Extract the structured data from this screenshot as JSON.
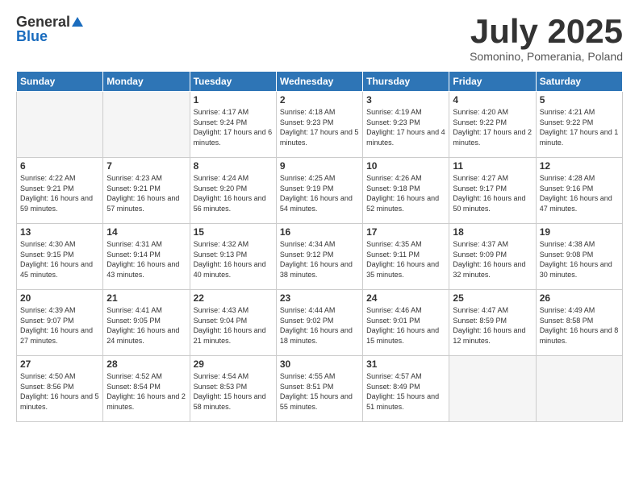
{
  "header": {
    "logo_general": "General",
    "logo_blue": "Blue",
    "month_title": "July 2025",
    "location": "Somonino, Pomerania, Poland"
  },
  "days_of_week": [
    "Sunday",
    "Monday",
    "Tuesday",
    "Wednesday",
    "Thursday",
    "Friday",
    "Saturday"
  ],
  "weeks": [
    [
      {
        "day": "",
        "empty": true
      },
      {
        "day": "",
        "empty": true
      },
      {
        "day": "1",
        "sunrise": "Sunrise: 4:17 AM",
        "sunset": "Sunset: 9:24 PM",
        "daylight": "Daylight: 17 hours and 6 minutes."
      },
      {
        "day": "2",
        "sunrise": "Sunrise: 4:18 AM",
        "sunset": "Sunset: 9:23 PM",
        "daylight": "Daylight: 17 hours and 5 minutes."
      },
      {
        "day": "3",
        "sunrise": "Sunrise: 4:19 AM",
        "sunset": "Sunset: 9:23 PM",
        "daylight": "Daylight: 17 hours and 4 minutes."
      },
      {
        "day": "4",
        "sunrise": "Sunrise: 4:20 AM",
        "sunset": "Sunset: 9:22 PM",
        "daylight": "Daylight: 17 hours and 2 minutes."
      },
      {
        "day": "5",
        "sunrise": "Sunrise: 4:21 AM",
        "sunset": "Sunset: 9:22 PM",
        "daylight": "Daylight: 17 hours and 1 minute."
      }
    ],
    [
      {
        "day": "6",
        "sunrise": "Sunrise: 4:22 AM",
        "sunset": "Sunset: 9:21 PM",
        "daylight": "Daylight: 16 hours and 59 minutes."
      },
      {
        "day": "7",
        "sunrise": "Sunrise: 4:23 AM",
        "sunset": "Sunset: 9:21 PM",
        "daylight": "Daylight: 16 hours and 57 minutes."
      },
      {
        "day": "8",
        "sunrise": "Sunrise: 4:24 AM",
        "sunset": "Sunset: 9:20 PM",
        "daylight": "Daylight: 16 hours and 56 minutes."
      },
      {
        "day": "9",
        "sunrise": "Sunrise: 4:25 AM",
        "sunset": "Sunset: 9:19 PM",
        "daylight": "Daylight: 16 hours and 54 minutes."
      },
      {
        "day": "10",
        "sunrise": "Sunrise: 4:26 AM",
        "sunset": "Sunset: 9:18 PM",
        "daylight": "Daylight: 16 hours and 52 minutes."
      },
      {
        "day": "11",
        "sunrise": "Sunrise: 4:27 AM",
        "sunset": "Sunset: 9:17 PM",
        "daylight": "Daylight: 16 hours and 50 minutes."
      },
      {
        "day": "12",
        "sunrise": "Sunrise: 4:28 AM",
        "sunset": "Sunset: 9:16 PM",
        "daylight": "Daylight: 16 hours and 47 minutes."
      }
    ],
    [
      {
        "day": "13",
        "sunrise": "Sunrise: 4:30 AM",
        "sunset": "Sunset: 9:15 PM",
        "daylight": "Daylight: 16 hours and 45 minutes."
      },
      {
        "day": "14",
        "sunrise": "Sunrise: 4:31 AM",
        "sunset": "Sunset: 9:14 PM",
        "daylight": "Daylight: 16 hours and 43 minutes."
      },
      {
        "day": "15",
        "sunrise": "Sunrise: 4:32 AM",
        "sunset": "Sunset: 9:13 PM",
        "daylight": "Daylight: 16 hours and 40 minutes."
      },
      {
        "day": "16",
        "sunrise": "Sunrise: 4:34 AM",
        "sunset": "Sunset: 9:12 PM",
        "daylight": "Daylight: 16 hours and 38 minutes."
      },
      {
        "day": "17",
        "sunrise": "Sunrise: 4:35 AM",
        "sunset": "Sunset: 9:11 PM",
        "daylight": "Daylight: 16 hours and 35 minutes."
      },
      {
        "day": "18",
        "sunrise": "Sunrise: 4:37 AM",
        "sunset": "Sunset: 9:09 PM",
        "daylight": "Daylight: 16 hours and 32 minutes."
      },
      {
        "day": "19",
        "sunrise": "Sunrise: 4:38 AM",
        "sunset": "Sunset: 9:08 PM",
        "daylight": "Daylight: 16 hours and 30 minutes."
      }
    ],
    [
      {
        "day": "20",
        "sunrise": "Sunrise: 4:39 AM",
        "sunset": "Sunset: 9:07 PM",
        "daylight": "Daylight: 16 hours and 27 minutes."
      },
      {
        "day": "21",
        "sunrise": "Sunrise: 4:41 AM",
        "sunset": "Sunset: 9:05 PM",
        "daylight": "Daylight: 16 hours and 24 minutes."
      },
      {
        "day": "22",
        "sunrise": "Sunrise: 4:43 AM",
        "sunset": "Sunset: 9:04 PM",
        "daylight": "Daylight: 16 hours and 21 minutes."
      },
      {
        "day": "23",
        "sunrise": "Sunrise: 4:44 AM",
        "sunset": "Sunset: 9:02 PM",
        "daylight": "Daylight: 16 hours and 18 minutes."
      },
      {
        "day": "24",
        "sunrise": "Sunrise: 4:46 AM",
        "sunset": "Sunset: 9:01 PM",
        "daylight": "Daylight: 16 hours and 15 minutes."
      },
      {
        "day": "25",
        "sunrise": "Sunrise: 4:47 AM",
        "sunset": "Sunset: 8:59 PM",
        "daylight": "Daylight: 16 hours and 12 minutes."
      },
      {
        "day": "26",
        "sunrise": "Sunrise: 4:49 AM",
        "sunset": "Sunset: 8:58 PM",
        "daylight": "Daylight: 16 hours and 8 minutes."
      }
    ],
    [
      {
        "day": "27",
        "sunrise": "Sunrise: 4:50 AM",
        "sunset": "Sunset: 8:56 PM",
        "daylight": "Daylight: 16 hours and 5 minutes."
      },
      {
        "day": "28",
        "sunrise": "Sunrise: 4:52 AM",
        "sunset": "Sunset: 8:54 PM",
        "daylight": "Daylight: 16 hours and 2 minutes."
      },
      {
        "day": "29",
        "sunrise": "Sunrise: 4:54 AM",
        "sunset": "Sunset: 8:53 PM",
        "daylight": "Daylight: 15 hours and 58 minutes."
      },
      {
        "day": "30",
        "sunrise": "Sunrise: 4:55 AM",
        "sunset": "Sunset: 8:51 PM",
        "daylight": "Daylight: 15 hours and 55 minutes."
      },
      {
        "day": "31",
        "sunrise": "Sunrise: 4:57 AM",
        "sunset": "Sunset: 8:49 PM",
        "daylight": "Daylight: 15 hours and 51 minutes."
      },
      {
        "day": "",
        "empty": true
      },
      {
        "day": "",
        "empty": true
      }
    ]
  ]
}
